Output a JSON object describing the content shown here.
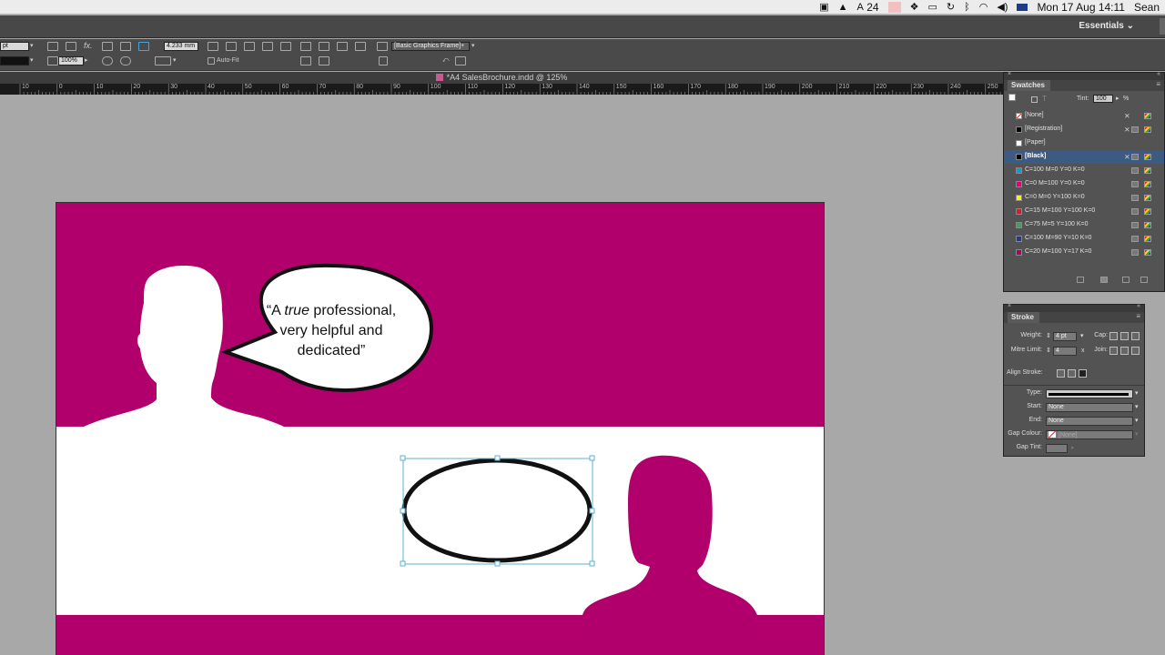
{
  "menubar": {
    "adobe_count": "24",
    "datetime": "Mon 17 Aug  14:11",
    "user": "Sean"
  },
  "appbar": {
    "workspace": "Essentials"
  },
  "control": {
    "stroke_unit": "pt",
    "scale_value": "100%",
    "dimension_value": "4.233 mm",
    "autofit_label": "Auto-Fit",
    "object_style": "[Basic Graphics Frame]+"
  },
  "document": {
    "tab_title": "*A4 SalesBrochure.indd @ 125%"
  },
  "ruler": {
    "labels": [
      "10",
      "0",
      "10",
      "20",
      "30",
      "40",
      "50",
      "60",
      "70",
      "80",
      "90",
      "100",
      "110",
      "120",
      "130",
      "140",
      "150",
      "160",
      "170",
      "180",
      "190",
      "200",
      "210",
      "220",
      "230",
      "240",
      "250"
    ]
  },
  "page_content": {
    "bubble_line1_pre": "“A ",
    "bubble_line1_italic": "true",
    "bubble_line1_post": " professional,",
    "bubble_line2": "very helpful and",
    "bubble_line3": "dedicated”",
    "colors": {
      "magenta": "#b1006c",
      "white": "#ffffff",
      "stroke": "#111111",
      "selection": "#5ab0d6"
    }
  },
  "swatches": {
    "title": "Swatches",
    "tint_label": "Tint:",
    "tint_value": "100",
    "tint_unit": "%",
    "items": [
      {
        "name": "[None]",
        "color": "none"
      },
      {
        "name": "[Registration]",
        "color": "#000000"
      },
      {
        "name": "[Paper]",
        "color": "#ffffff"
      },
      {
        "name": "[Black]",
        "color": "#000000"
      },
      {
        "name": "C=100 M=0 Y=0 K=0",
        "color": "#00a0e0"
      },
      {
        "name": "C=0 M=100 Y=0 K=0",
        "color": "#e4007c"
      },
      {
        "name": "C=0 M=0 Y=100 K=0",
        "color": "#fff200"
      },
      {
        "name": "C=15 M=100 Y=100 K=0",
        "color": "#d0202e"
      },
      {
        "name": "C=75 M=5 Y=100 K=0",
        "color": "#34a853"
      },
      {
        "name": "C=100 M=90 Y=10 K=0",
        "color": "#233b8c"
      },
      {
        "name": "C=20 M=100 Y=17 K=0",
        "color": "#b1006c"
      }
    ]
  },
  "stroke_panel": {
    "title": "Stroke",
    "weight_label": "Weight:",
    "weight_value": "4 pt",
    "cap_label": "Cap:",
    "mitre_label": "Mitre Limit:",
    "mitre_value": "4",
    "mitre_x": "x",
    "join_label": "Join:",
    "align_label": "Align Stroke:",
    "type_label": "Type:",
    "start_label": "Start:",
    "start_value": "None",
    "end_label": "End:",
    "end_value": "None",
    "gap_colour_label": "Gap Colour:",
    "gap_colour_value": "[None]",
    "gap_tint_label": "Gap Tint:"
  }
}
